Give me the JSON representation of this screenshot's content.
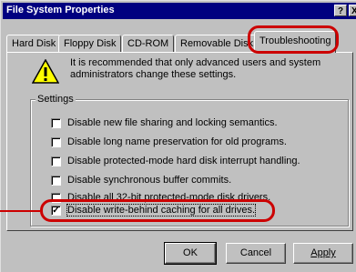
{
  "window": {
    "title": "File System Properties",
    "help_button": "?",
    "close_button": "X"
  },
  "tabs": [
    {
      "label": "Hard Disk",
      "active": false
    },
    {
      "label": "Floppy Disk",
      "active": false
    },
    {
      "label": "CD-ROM",
      "active": false
    },
    {
      "label": "Removable Disk",
      "active": false
    },
    {
      "label": "Troubleshooting",
      "active": true
    }
  ],
  "warning": {
    "icon": "warning-icon",
    "text": "It is recommended that only advanced users and system administrators change these settings."
  },
  "settings": {
    "legend": "Settings",
    "options": [
      {
        "label": "Disable new file sharing and locking semantics.",
        "checked": false
      },
      {
        "label": "Disable long name preservation for old programs.",
        "checked": false
      },
      {
        "label": "Disable protected-mode hard disk interrupt handling.",
        "checked": false
      },
      {
        "label": "Disable synchronous buffer commits.",
        "checked": false
      },
      {
        "label": "Disable all 32-bit protected-mode disk drivers.",
        "checked": false
      },
      {
        "label": "Disable write-behind caching for all drives.",
        "checked": true
      }
    ]
  },
  "buttons": {
    "ok": "OK",
    "cancel": "Cancel",
    "apply": "Apply"
  },
  "colors": {
    "titlebar": "#000080",
    "face": "#c0c0c0",
    "highlight_ring": "#cc0000"
  }
}
